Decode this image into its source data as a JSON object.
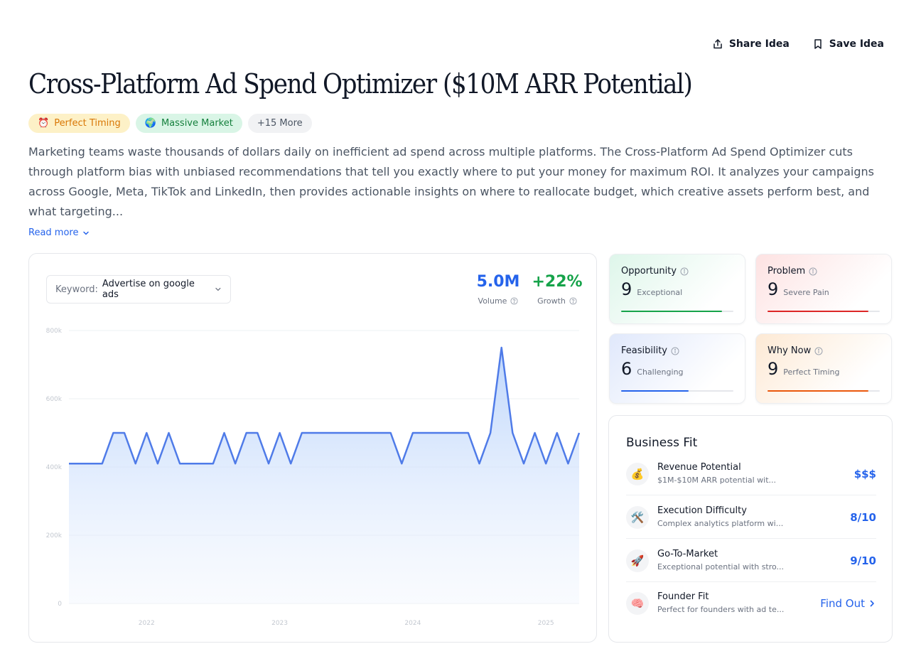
{
  "actions": {
    "share_label": "Share Idea",
    "save_label": "Save Idea"
  },
  "title": "Cross-Platform Ad Spend Optimizer ($10M ARR Potential)",
  "badges": [
    {
      "icon": "⏰",
      "label": "Perfect Timing"
    },
    {
      "icon": "🌍",
      "label": "Massive Market"
    },
    {
      "label": "+15 More"
    }
  ],
  "description": "Marketing teams waste thousands of dollars daily on inefficient ad spend across multiple platforms. The Cross-Platform Ad Spend Optimizer cuts through platform bias with unbiased recommendations that tell you exactly where to put your money for maximum ROI. It analyzes your campaigns across Google, Meta, TikTok and LinkedIn, then provides actionable insights on where to reallocate budget, which creative assets perform best, and what targeting...",
  "read_more": "Read more",
  "keyword": {
    "label": "Keyword:",
    "value": "Advertise on google ads"
  },
  "metrics": {
    "volume": {
      "value": "5.0M",
      "label": "Volume"
    },
    "growth": {
      "value": "+22%",
      "label": "Growth"
    }
  },
  "chart_data": {
    "type": "area",
    "y_ticks": [
      "0",
      "200k",
      "400k",
      "600k",
      "800k"
    ],
    "y_tick_values": [
      0,
      200000,
      400000,
      600000,
      800000
    ],
    "ylim": [
      0,
      800000
    ],
    "x_ticks": [
      "2022",
      "2023",
      "2024",
      "2025"
    ],
    "x_tick_index": [
      7,
      19,
      31,
      43
    ],
    "color": "#4f7be8",
    "values": [
      410000,
      410000,
      410000,
      410000,
      500000,
      500000,
      410000,
      500000,
      410000,
      500000,
      410000,
      410000,
      410000,
      410000,
      500000,
      410000,
      500000,
      500000,
      410000,
      500000,
      410000,
      500000,
      500000,
      500000,
      500000,
      500000,
      500000,
      500000,
      500000,
      500000,
      410000,
      500000,
      500000,
      500000,
      500000,
      500000,
      500000,
      410000,
      500000,
      750000,
      500000,
      410000,
      500000,
      410000,
      500000,
      410000,
      500000
    ]
  },
  "scores": {
    "opportunity": {
      "title": "Opportunity",
      "score": "9",
      "word": "Exceptional",
      "fraction": 0.9,
      "color": "#16a34a"
    },
    "problem": {
      "title": "Problem",
      "score": "9",
      "word": "Severe Pain",
      "fraction": 0.9,
      "color": "#dc2626"
    },
    "feasibility": {
      "title": "Feasibility",
      "score": "6",
      "word": "Challenging",
      "fraction": 0.6,
      "color": "#2563eb"
    },
    "why_now": {
      "title": "Why Now",
      "score": "9",
      "word": "Perfect Timing",
      "fraction": 0.9,
      "color": "#ea580c"
    }
  },
  "business_fit": {
    "title": "Business Fit",
    "rows": [
      {
        "icon": "💰",
        "label": "Revenue Potential",
        "sub": "$1M-$10M ARR potential wit...",
        "value": "$$$"
      },
      {
        "icon": "🛠️",
        "label": "Execution Difficulty",
        "sub": "Complex analytics platform wi...",
        "value": "8/10"
      },
      {
        "icon": "🚀",
        "label": "Go-To-Market",
        "sub": "Exceptional potential with stro...",
        "value": "9/10"
      },
      {
        "icon": "🧠",
        "label": "Founder Fit",
        "sub": "Perfect for founders with ad te...",
        "value": "Find Out"
      }
    ]
  }
}
